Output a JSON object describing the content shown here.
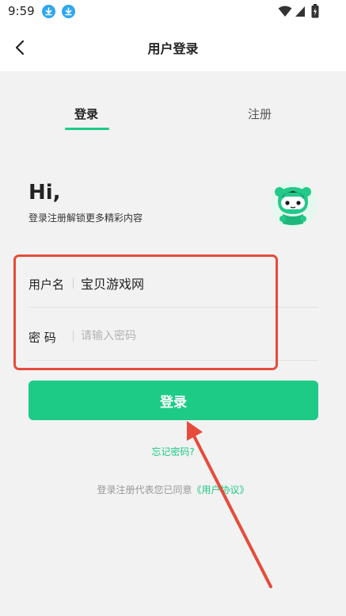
{
  "status_bar": {
    "time": "9:59"
  },
  "header": {
    "title": "用户登录"
  },
  "tabs": {
    "login": "登录",
    "register": "注册"
  },
  "greeting": {
    "title": "Hi,",
    "subtitle": "登录注册解锁更多精彩内容"
  },
  "form": {
    "username_label": "用户名",
    "username_value": "宝贝游戏网",
    "password_label": "密 码",
    "password_placeholder": "请输入密码"
  },
  "actions": {
    "login_button": "登录",
    "forgot_password": "忘记密码?"
  },
  "agreement": {
    "prefix": "登录注册代表您已同意",
    "link_text": "《用户协议》"
  },
  "colors": {
    "accent": "#1ecb86",
    "annotation": "#e64b3b",
    "background": "#f2f2f2"
  },
  "icons": [
    "download-icon",
    "wifi-icon",
    "signal-icon",
    "battery-icon",
    "back-arrow-icon",
    "mascot-icon"
  ]
}
